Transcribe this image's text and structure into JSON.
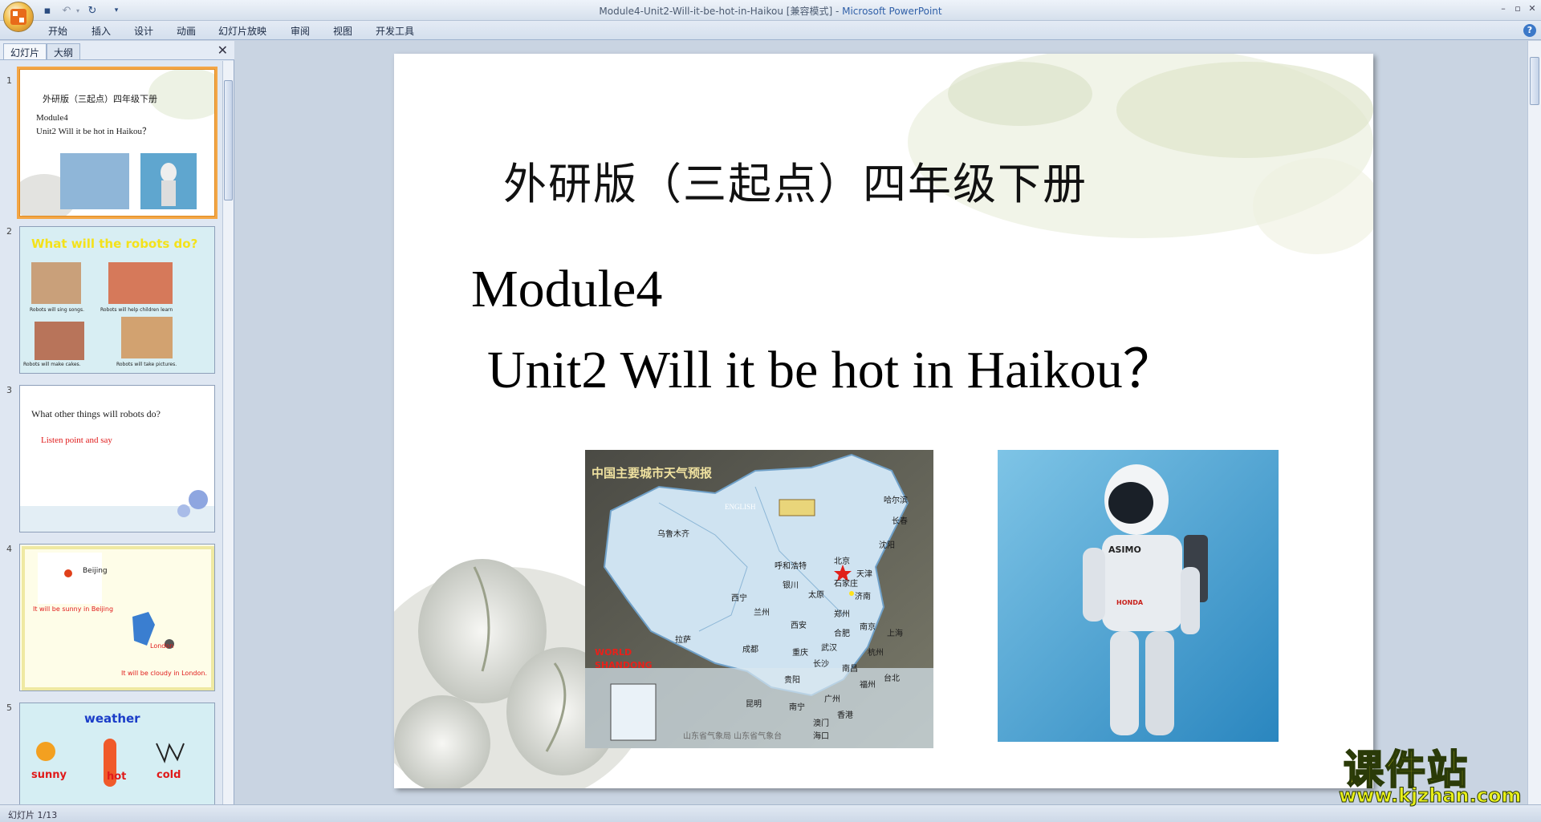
{
  "window": {
    "title": "Module4-Unit2-Will-it-be-hot-in-Haikou [兼容模式]",
    "separator": " - ",
    "app_name": "Microsoft PowerPoint"
  },
  "ribbon": {
    "tabs": [
      "开始",
      "插入",
      "设计",
      "动画",
      "幻灯片放映",
      "审阅",
      "视图",
      "开发工具"
    ]
  },
  "panel": {
    "tab_slides": "幻灯片",
    "tab_outline": "大纲"
  },
  "thumbnails": [
    {
      "num": "1",
      "line1": "外研版（三起点）四年级下册",
      "line2": "Module4",
      "line3": "Unit2  Will  it  be hot in Haikou？"
    },
    {
      "num": "2",
      "title": "What will the robots do?",
      "cap1": "Robots will sing songs.",
      "cap2": "Robots will help children learn",
      "cap3": "Robots will make cakes.",
      "cap4": "Robots will take pictures."
    },
    {
      "num": "3",
      "title": "What other things will robots do?",
      "sub": "Listen point and say"
    },
    {
      "num": "4",
      "cap_beijing": "Beijing",
      "cap_sunny": "It will be sunny in Beijing",
      "cap_london": "London",
      "cap_cloudy": "It will be cloudy in London."
    },
    {
      "num": "5",
      "title": "weather",
      "w1": "sunny",
      "w2": "hot",
      "w3": "cold"
    }
  ],
  "slide": {
    "title": "外研版（三起点）四年级下册",
    "module": "Module4",
    "unit": "Unit2 Will it be hot in Haikou？",
    "map": {
      "header": "中国主要城市天气预报",
      "english": "ENGLISH",
      "world": "WORLD",
      "shandong": "SHANDONG",
      "footer": "山东省气象局   山东省气象台",
      "cities": [
        "乌鲁木齐",
        "哈尔滨",
        "长春",
        "沈阳",
        "呼和浩特",
        "北京",
        "天津",
        "石家庄",
        "银川",
        "太原",
        "济南",
        "西宁",
        "兰州",
        "郑州",
        "西安",
        "合肥",
        "南京",
        "上海",
        "拉萨",
        "成都",
        "重庆",
        "武汉",
        "杭州",
        "长沙",
        "南昌",
        "贵阳",
        "福州",
        "台北",
        "昆明",
        "南宁",
        "广州",
        "香港",
        "澳门",
        "海口"
      ]
    },
    "robot": {
      "label": "ASIMO",
      "brand": "HONDA"
    }
  },
  "status": {
    "text": "幻灯片 1/13"
  },
  "watermark": {
    "cn": "课件站",
    "url": "www.kjzhan.com"
  }
}
